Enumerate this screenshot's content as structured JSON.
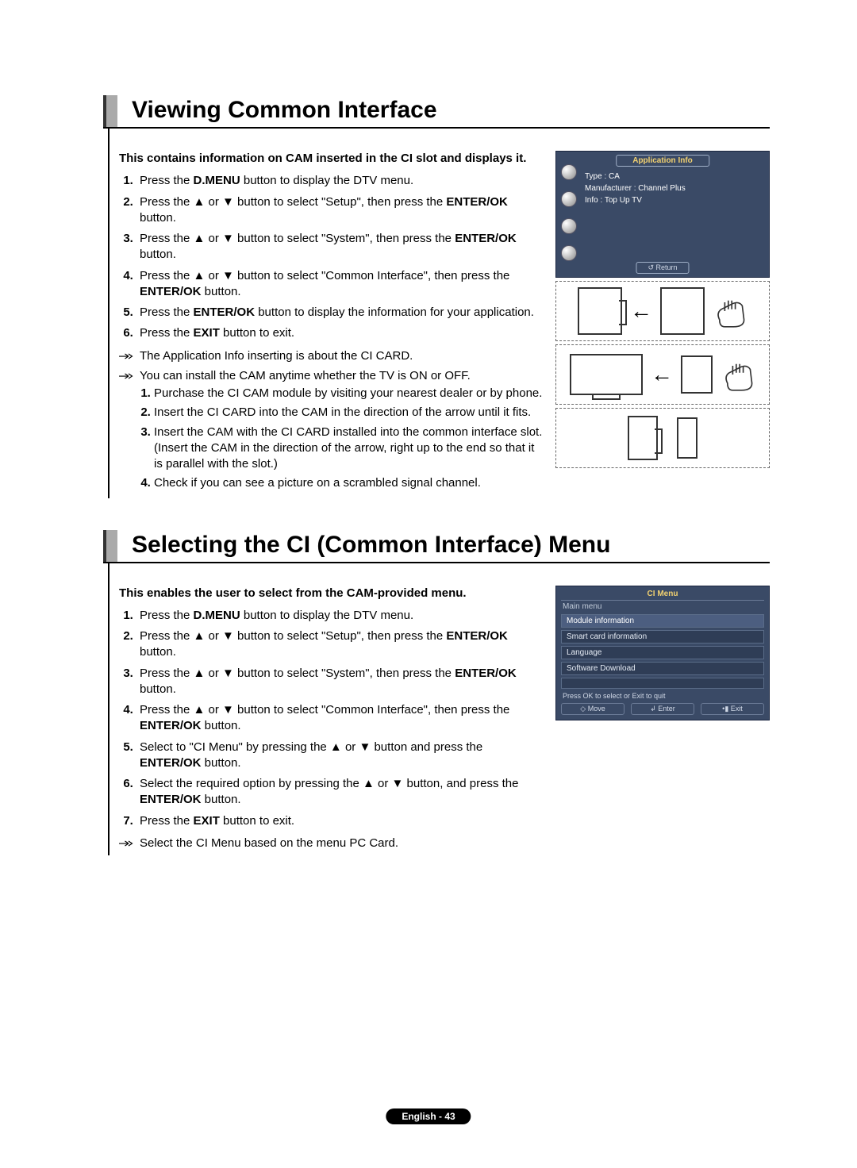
{
  "section1": {
    "heading": "Viewing Common Interface",
    "lead": "This contains information on CAM inserted in the CI slot and displays it.",
    "steps": [
      {
        "pre": "Press the ",
        "b": "D.MENU",
        "post": " button to display the DTV menu."
      },
      {
        "pre": "Press the ▲ or ▼ button to select \"Setup\", then press the ",
        "b": "ENTER/OK",
        "post": " button."
      },
      {
        "pre": "Press the ▲ or ▼ button to select \"System\", then press the ",
        "b": "ENTER/OK",
        "post": " button."
      },
      {
        "pre": "Press the ▲ or ▼ button to select \"Common Interface\", then press the ",
        "b": "ENTER/OK",
        "post": " button."
      },
      {
        "pre": "Press the ",
        "b": "ENTER/OK",
        "post": " button to display the information for your application."
      },
      {
        "pre": "Press the ",
        "b": "EXIT",
        "post": " button to exit."
      }
    ],
    "note1": "The Application Info inserting is about the CI CARD.",
    "note2": "You can install the CAM anytime whether the TV is ON or OFF.",
    "substeps": [
      "Purchase the CI CAM module by visiting your nearest dealer or by phone.",
      "Insert the CI CARD into the CAM in the direction of the arrow until it fits.",
      "Insert the CAM with the CI CARD installed into the common interface slot.",
      "Check if you can see a picture on a scrambled signal channel."
    ],
    "sub_paren": "(Insert the CAM in the direction of the arrow, right up to the end so that it is parallel with the slot.)",
    "osd": {
      "title": "Application Info",
      "line1": "Type : CA",
      "line2": "Manufacturer : Channel Plus",
      "line3": "Info : Top Up TV",
      "return": "Return"
    }
  },
  "section2": {
    "heading": "Selecting the CI (Common Interface) Menu",
    "lead": "This enables the user to select from the CAM-provided menu.",
    "steps": [
      {
        "pre": "Press the ",
        "b": "D.MENU",
        "post": " button to display the DTV menu."
      },
      {
        "pre": "Press the ▲ or ▼ button to select \"Setup\", then press the ",
        "b": "ENTER/OK",
        "post": " button."
      },
      {
        "pre": "Press the ▲ or ▼ button to select \"System\", then press the ",
        "b": "ENTER/OK",
        "post": " button."
      },
      {
        "pre": "Press the ▲ or ▼ button to select \"Common Interface\", then press the ",
        "b": "ENTER/OK",
        "post": " button."
      },
      {
        "pre": "Select to \"CI Menu\" by pressing the ▲ or ▼ button and press the ",
        "b": "ENTER/OK",
        "post": " button."
      },
      {
        "pre": "Select the required option by pressing the ▲ or ▼ button, and press the ",
        "b": "ENTER/OK",
        "post": " button."
      },
      {
        "pre": "Press the ",
        "b": "EXIT",
        "post": " button to exit."
      }
    ],
    "note1": "Select the CI Menu based on the menu PC Card.",
    "osd": {
      "title": "CI Menu",
      "main_label": "Main menu",
      "items": [
        "Module information",
        "Smart card information",
        "Language",
        "Software Download"
      ],
      "hint": "Press OK to select or Exit to quit",
      "footer": {
        "move": "Move",
        "enter": "Enter",
        "exit": "Exit"
      },
      "footer_icons": {
        "move": "◇",
        "enter": "↲",
        "exit": "•▮"
      }
    }
  },
  "footer": "English - 43"
}
